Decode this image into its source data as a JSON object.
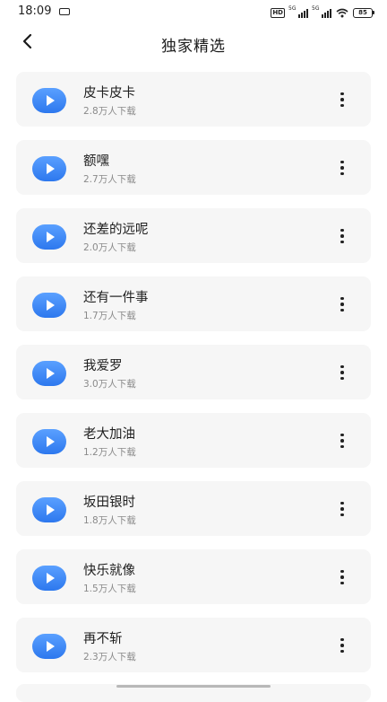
{
  "status_bar": {
    "time": "18:09",
    "hd_label": "HD",
    "signal1_label": "5G",
    "signal2_label": "5G",
    "battery": "85"
  },
  "header": {
    "title": "独家精选",
    "back_icon": "chevron-left-icon"
  },
  "items": [
    {
      "title": "皮卡皮卡",
      "downloads": "2.8万人下载"
    },
    {
      "title": "额嘿",
      "downloads": "2.7万人下载"
    },
    {
      "title": "还差的远呢",
      "downloads": "2.0万人下载"
    },
    {
      "title": "还有一件事",
      "downloads": "1.7万人下载"
    },
    {
      "title": "我爱罗",
      "downloads": "3.0万人下载"
    },
    {
      "title": "老大加油",
      "downloads": "1.2万人下载"
    },
    {
      "title": "坂田银时",
      "downloads": "1.8万人下载"
    },
    {
      "title": "快乐就像",
      "downloads": "1.5万人下载"
    },
    {
      "title": "再不斩",
      "downloads": "2.3万人下载"
    }
  ],
  "colors": {
    "accent": "#3a86f5",
    "card_bg": "#f6f6f6",
    "subtext": "#8a8a8a"
  }
}
